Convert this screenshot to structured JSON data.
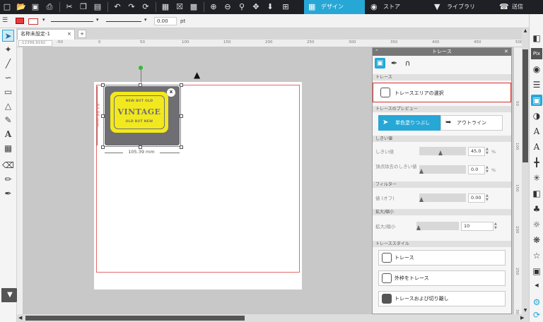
{
  "tabs": {
    "design": "デザイン",
    "store": "ストア",
    "library": "ライブラリ",
    "send": "送信"
  },
  "options": {
    "line_width_value": "0.00",
    "line_width_unit": "pt"
  },
  "doc_tab": {
    "label": "名称未設定-1",
    "close": "×",
    "add": "+"
  },
  "ruler": {
    "coords": "-12399,9192",
    "labels": [
      "-50",
      "0",
      "50",
      "100",
      "150",
      "200",
      "250",
      "300",
      "350",
      "400",
      "450",
      "500"
    ],
    "v_labels": [
      "50",
      "100",
      "150",
      "200",
      "250",
      "300"
    ]
  },
  "artwork": {
    "line1": "NEW BUT OLD",
    "line2": "VINTAGE",
    "line3": "OLD BUT NEW",
    "width_label": "105.39 mm",
    "height_label": "84.88 mm",
    "close": "x"
  },
  "panel": {
    "title": "トレース",
    "sections": {
      "trace": "トレース",
      "preview": "トレースのプレビュー",
      "threshold": "しきい値",
      "filter": "フィルター",
      "scale": "拡大/縮小",
      "trace_style": "トレーススタイル"
    },
    "select_area": "トレースエリアの選択",
    "preview_fill": "単色塗りつぶし",
    "preview_outline": "アウトライン",
    "threshold_label": "しきい値",
    "threshold_value": "45.0",
    "threshold_unit": "%",
    "highpass_label": "頂点除去のしきい値",
    "highpass_value": "0.0",
    "highpass_unit": "%",
    "filter_label": "値 (オフ)",
    "filter_value": "0.00",
    "scale_label": "拡大/縮小",
    "scale_value": "10",
    "btn_trace": "トレース",
    "btn_trace_outer": "外枠をトレース",
    "btn_trace_detach": "トレースおよび切り離し"
  },
  "colors": {
    "accent": "#27a7d6",
    "highlight": "#d9322f",
    "badge": "#f2e81e"
  }
}
